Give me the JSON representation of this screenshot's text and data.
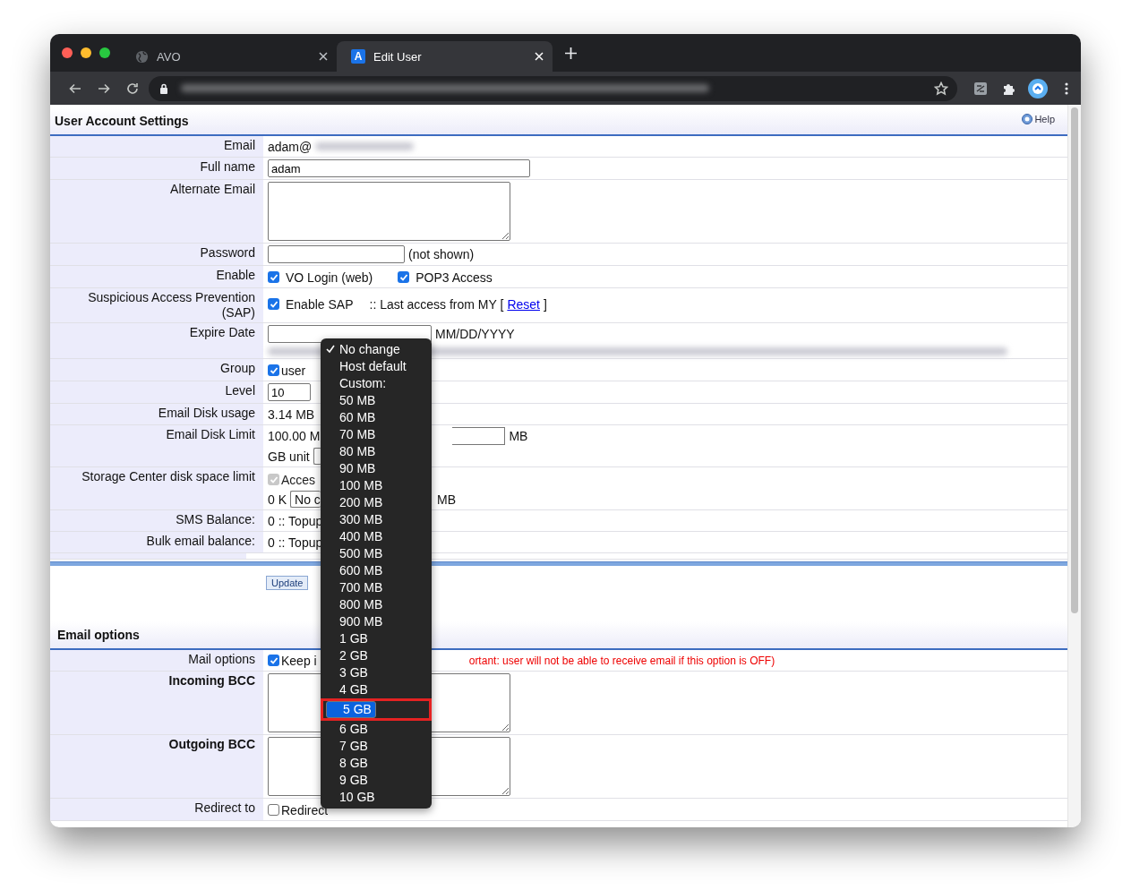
{
  "browser": {
    "tabs": [
      {
        "title": "AVO",
        "selected": false,
        "kind": "site"
      },
      {
        "title": "Edit User",
        "selected": true,
        "kind": "app",
        "icon_text": "A"
      }
    ]
  },
  "settings": {
    "title": "User Account Settings",
    "help": "Help",
    "rows": [
      {
        "label": "Email",
        "kind": "text",
        "value": "adam@",
        "redacted": true
      },
      {
        "label": "Full name",
        "kind": "input",
        "value": "adam"
      },
      {
        "label": "Alternate Email",
        "kind": "textarea"
      },
      {
        "label": "Password",
        "kind": "password",
        "suffix": "(not shown)"
      },
      {
        "label": "Enable",
        "kind": "checks",
        "checks": [
          {
            "label": "VO Login (web)",
            "checked": true
          },
          {
            "label": "POP3 Access",
            "checked": true
          }
        ]
      },
      {
        "label": "Suspicious Access Prevention (SAP)",
        "kind": "sap",
        "checks": [
          {
            "label": "Enable SAP",
            "checked": true
          }
        ],
        "note": ":: Last access from MY [",
        "link": "Reset",
        "note_end": "]"
      },
      {
        "label": "Expire Date",
        "kind": "date",
        "hint": "MM/DD/YYYY",
        "redacted": true
      },
      {
        "label": "Group",
        "kind": "checks",
        "checks": [
          {
            "label": "user",
            "checked": true
          }
        ]
      },
      {
        "label": "Level",
        "kind": "small-input",
        "value": "10"
      },
      {
        "label": "Email Disk usage",
        "kind": "text",
        "value": "3.14 MB"
      },
      {
        "label": "Email Disk Limit",
        "kind": "limit",
        "value": "100.00 M",
        "unit": "MB",
        "second": "GB unit"
      },
      {
        "label": "Storage Center disk space limit",
        "kind": "storage",
        "checks": [
          {
            "label": "Acces",
            "checked": true,
            "disabled": true
          }
        ],
        "value": "0 K",
        "select": "No c",
        "unit": "MB"
      },
      {
        "label": "SMS Balance:",
        "kind": "text",
        "value": "0 :: Topup"
      },
      {
        "label": "Bulk email balance:",
        "kind": "text",
        "value": "0 :: Topup"
      }
    ],
    "button": "Update"
  },
  "email_options": {
    "title": "Email options",
    "rows": [
      {
        "label": "Mail options",
        "kind": "keep",
        "checks": [
          {
            "label": "Keep i",
            "checked": true
          }
        ],
        "warning": "ortant: user will not be able to receive email if this option is OFF)"
      },
      {
        "label": "Incoming BCC",
        "kind": "textarea",
        "bold": true
      },
      {
        "label": "Outgoing BCC",
        "kind": "textarea",
        "bold": true
      },
      {
        "label": "Redirect to",
        "kind": "checks",
        "checks": [
          {
            "label": "Redirect",
            "checked": false
          }
        ]
      }
    ]
  },
  "dropdown": {
    "items": [
      {
        "label": "No change",
        "checked": true,
        "selected": false,
        "framed": false
      },
      {
        "label": "Host default",
        "checked": false,
        "selected": false,
        "framed": false
      },
      {
        "label": "Custom:",
        "checked": false,
        "selected": false,
        "framed": false
      },
      {
        "label": "50 MB",
        "checked": false,
        "selected": false,
        "framed": false
      },
      {
        "label": "60 MB",
        "checked": false,
        "selected": false,
        "framed": false
      },
      {
        "label": "70 MB",
        "checked": false,
        "selected": false,
        "framed": false
      },
      {
        "label": "80 MB",
        "checked": false,
        "selected": false,
        "framed": false
      },
      {
        "label": "90 MB",
        "checked": false,
        "selected": false,
        "framed": false
      },
      {
        "label": "100 MB",
        "checked": false,
        "selected": false,
        "framed": false
      },
      {
        "label": "200 MB",
        "checked": false,
        "selected": false,
        "framed": false
      },
      {
        "label": "300 MB",
        "checked": false,
        "selected": false,
        "framed": false
      },
      {
        "label": "400 MB",
        "checked": false,
        "selected": false,
        "framed": false
      },
      {
        "label": "500 MB",
        "checked": false,
        "selected": false,
        "framed": false
      },
      {
        "label": "600 MB",
        "checked": false,
        "selected": false,
        "framed": false
      },
      {
        "label": "700 MB",
        "checked": false,
        "selected": false,
        "framed": false
      },
      {
        "label": "800 MB",
        "checked": false,
        "selected": false,
        "framed": false
      },
      {
        "label": "900 MB",
        "checked": false,
        "selected": false,
        "framed": false
      },
      {
        "label": "1 GB",
        "checked": false,
        "selected": false,
        "framed": false
      },
      {
        "label": "2 GB",
        "checked": false,
        "selected": false,
        "framed": false
      },
      {
        "label": "3 GB",
        "checked": false,
        "selected": false,
        "framed": false
      },
      {
        "label": "4 GB",
        "checked": false,
        "selected": false,
        "framed": false
      },
      {
        "label": "5 GB",
        "checked": false,
        "selected": true,
        "framed": true
      },
      {
        "label": "6 GB",
        "checked": false,
        "selected": false,
        "framed": false
      },
      {
        "label": "7 GB",
        "checked": false,
        "selected": false,
        "framed": false
      },
      {
        "label": "8 GB",
        "checked": false,
        "selected": false,
        "framed": false
      },
      {
        "label": "9 GB",
        "checked": false,
        "selected": false,
        "framed": false
      },
      {
        "label": "10 GB",
        "checked": false,
        "selected": false,
        "framed": false
      }
    ]
  }
}
